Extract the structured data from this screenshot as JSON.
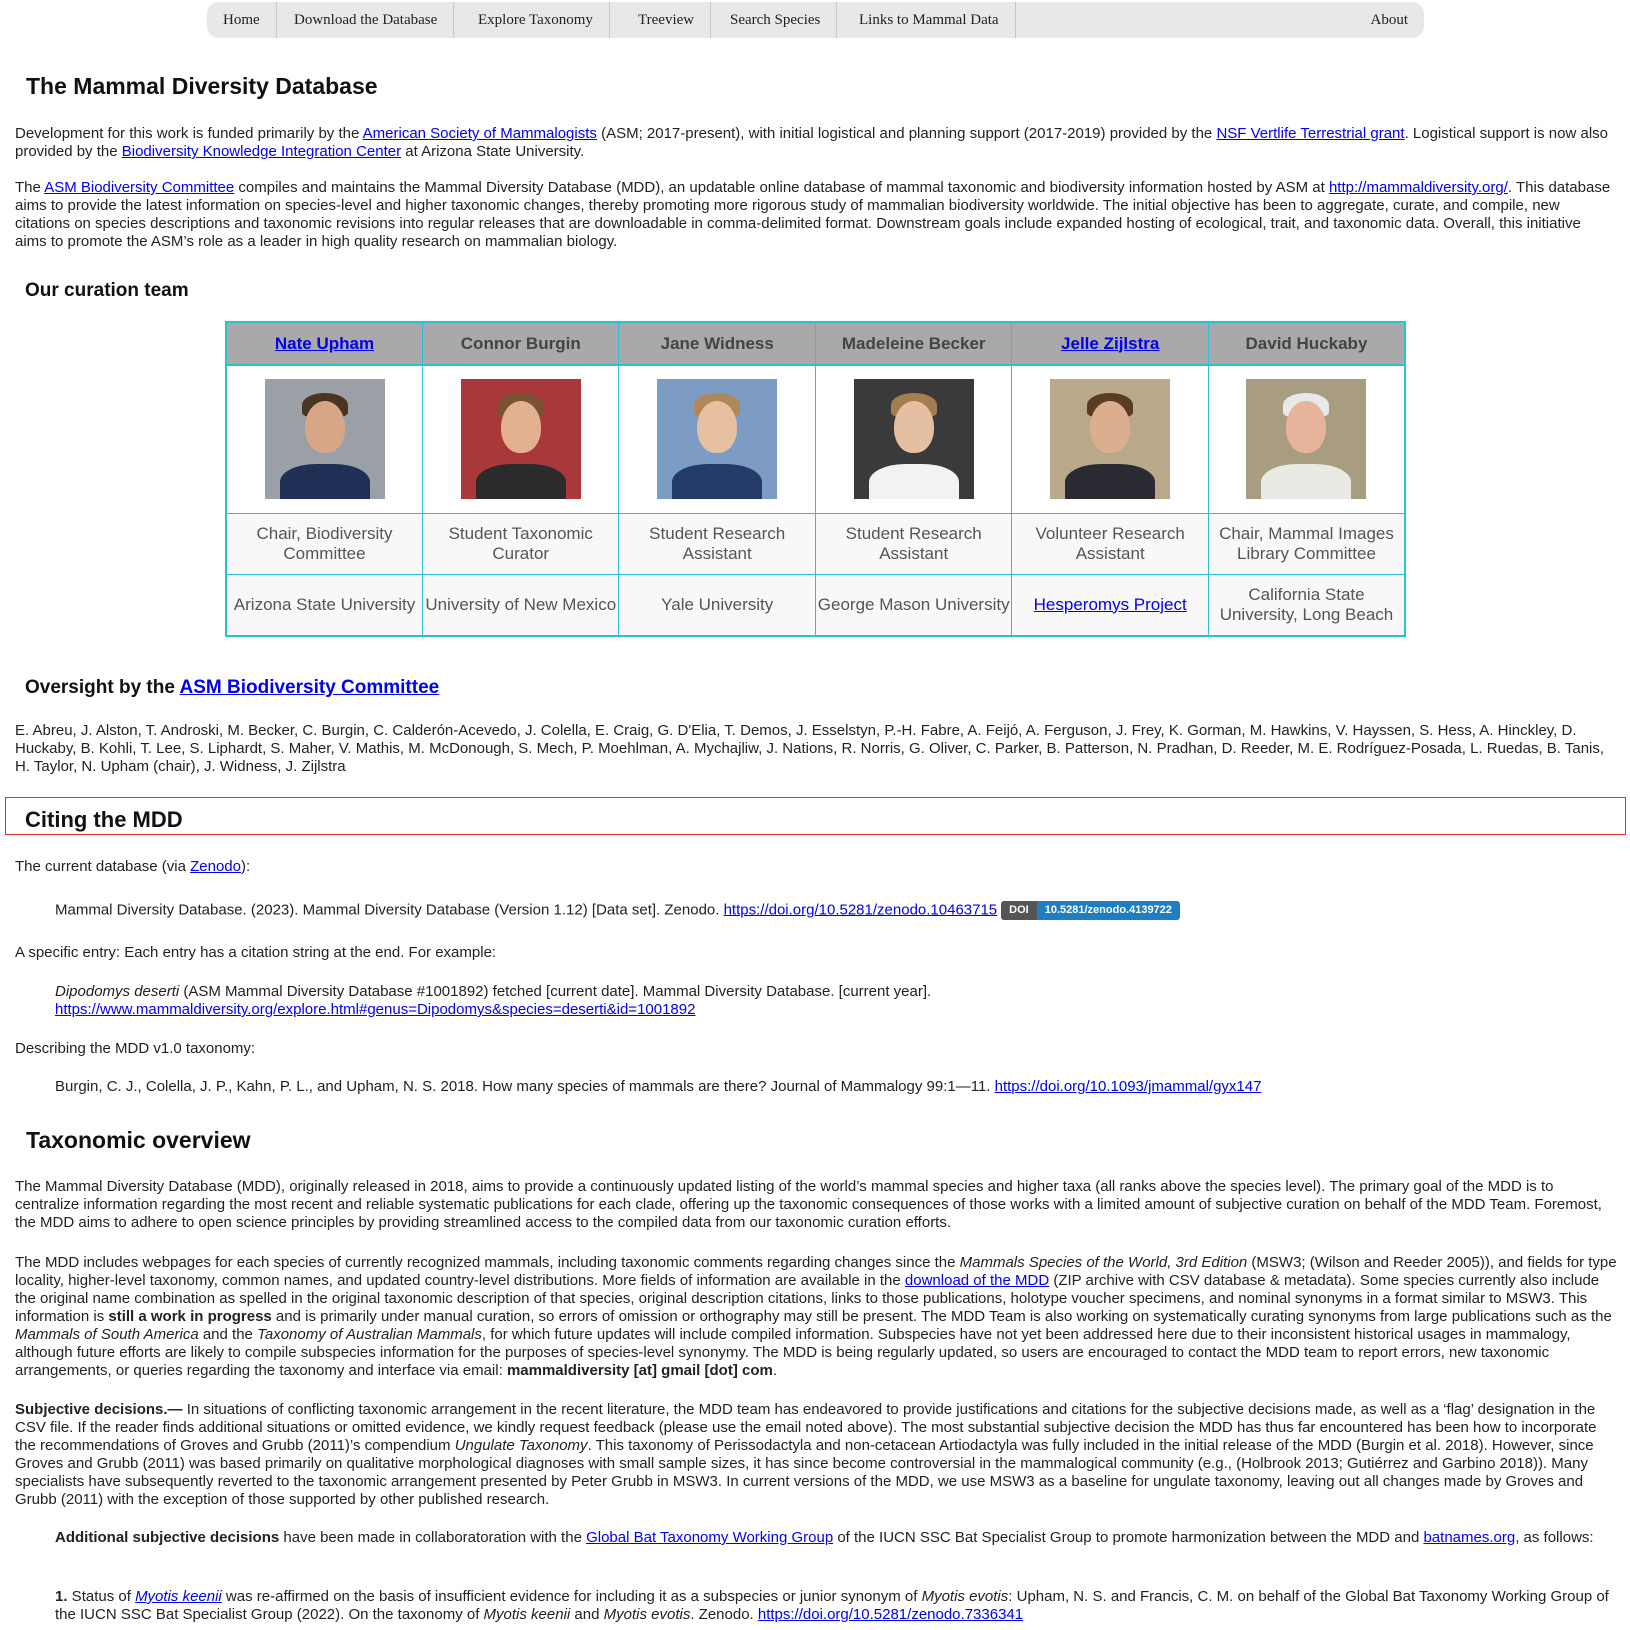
{
  "nav": {
    "home": "Home",
    "download": "Download the Database",
    "explore": "Explore Taxonomy",
    "treeview": "Treeview",
    "search": "Search Species",
    "links": "Links to Mammal Data",
    "about": "About"
  },
  "title": "The Mammal Diversity Database",
  "intro1": {
    "t1": "Development for this work is funded primarily by the ",
    "l1": "American Society of Mammalogists",
    "t2": " (ASM; 2017-present), with initial logistical and planning support (2017-2019) provided by the ",
    "l2": "NSF Vertlife Terrestrial grant",
    "t3": ". Logistical support is now also provided by the ",
    "l3": "Biodiversity Knowledge Integration Center",
    "t4": " at Arizona State University."
  },
  "intro2": {
    "t1": "The ",
    "l1": "ASM Biodiversity Committee",
    "t2": " compiles and maintains the Mammal Diversity Database (MDD), an updatable online database of mammal taxonomic and biodiversity information hosted by ASM at ",
    "l2": "http://mammaldiversity.org/",
    "t3": ". This database aims to provide the latest information on species-level and higher taxonomic changes, thereby promoting more rigorous study of mammalian biodiversity worldwide. The initial objective has been to aggregate, curate, and compile, new citations on species descriptions and taxonomic revisions into regular releases that are downloadable in comma-delimited format. Downstream goals include expanded hosting of ecological, trait, and taxonomic data. Overall, this initiative aims to promote the ASM’s role as a leader in high quality research on mammalian biology."
  },
  "team_heading": "Our curation team",
  "team": [
    {
      "name": "Nate Upham",
      "link": true,
      "role": "Chair, Biodiversity Committee",
      "inst": "Arizona State University",
      "inst_link": false,
      "bg": "#9aa0a6",
      "skin": "#d7a686",
      "hair": "#4a3524",
      "shirt": "#1f2f55"
    },
    {
      "name": "Connor Burgin",
      "link": false,
      "role": "Student Taxonomic Curator",
      "inst": "University of New Mexico",
      "inst_link": false,
      "bg": "#a8383a",
      "skin": "#e3b090",
      "hair": "#7a5132",
      "shirt": "#2b2b2b"
    },
    {
      "name": "Jane Widness",
      "link": false,
      "role": "Student Research Assistant",
      "inst": "Yale University",
      "inst_link": false,
      "bg": "#7c9cc4",
      "skin": "#e6c0a0",
      "hair": "#b08758",
      "shirt": "#243a6a"
    },
    {
      "name": "Madeleine Becker",
      "link": false,
      "role": "Student Research Assistant",
      "inst": "George Mason University",
      "inst_link": false,
      "bg": "#3a3a3a",
      "skin": "#e4bfa2",
      "hair": "#a57e50",
      "shirt": "#f2f2f2"
    },
    {
      "name": "Jelle Zijlstra",
      "link": true,
      "role": "Volunteer Research Assistant",
      "inst": "Hesperomys Project",
      "inst_link": true,
      "bg": "#b9a98a",
      "skin": "#dbae90",
      "hair": "#5a3c24",
      "shirt": "#2a2a33"
    },
    {
      "name": "David Huckaby",
      "link": false,
      "role": "Chair, Mammal Images Library Committee",
      "inst": "California State University, Long Beach",
      "inst_link": false,
      "bg": "#a89d80",
      "skin": "#e7b39a",
      "hair": "#e8e8e8",
      "shirt": "#eaeae4"
    }
  ],
  "oversight": {
    "t1": "Oversight by the ",
    "l1": "ASM Biodiversity Committee",
    "members": "E. Abreu, J. Alston, T. Androski, M. Becker, C. Burgin, C. Calderón-Acevedo, J. Colella, E. Craig, G. D'Elia, T. Demos, J. Esselstyn, P.-H. Fabre, A. Feijó, A. Ferguson, J. Frey, K. Gorman, M. Hawkins, V. Hayssen, S. Hess, A. Hinckley, D. Huckaby, B. Kohli, T. Lee, S. Liphardt, S. Maher, V. Mathis, M. McDonough, S. Mech, P. Moehlman, A. Mychajliw, J. Nations, R. Norris, G. Oliver, C. Parker, B. Patterson, N. Pradhan, D. Reeder, M. E. Rodríguez-Posada, L. Ruedas, B. Tanis, H. Taylor, N. Upham (chair), J. Widness, J. Zijlstra"
  },
  "citing": {
    "heading": "Citing the MDD",
    "current_t1": "The current database (via ",
    "current_l1": "Zenodo",
    "current_t2": "):",
    "db_cite": "Mammal Diversity Database. (2023). Mammal Diversity Database (Version 1.12) [Data set]. Zenodo. ",
    "db_link": "https://doi.org/10.5281/zenodo.10463715",
    "badge_left": "DOI",
    "badge_right": "10.5281/zenodo.4139722",
    "specific": "A specific entry: Each entry has a citation string at the end. For example:",
    "example_species": "Dipodomys deserti",
    "example_text": " (ASM Mammal Diversity Database #1001892) fetched [current date]. Mammal Diversity Database. [current year].",
    "example_link": "https://www.mammaldiversity.org/explore.html#genus=Dipodomys&species=deserti&id=1001892",
    "describing": "Describing the MDD v1.0 taxonomy:",
    "burgin": "Burgin, C. J., Colella, J. P., Kahn, P. L., and Upham, N. S. 2018. How many species of mammals are there? Journal of Mammalogy 99:1—11. ",
    "burgin_link": "https://doi.org/10.1093/jmammal/gyx147"
  },
  "taxonomic": {
    "heading": "Taxonomic overview",
    "p1": "The Mammal Diversity Database (MDD), originally released in 2018, aims to provide a continuously updated listing of the world’s mammal species and higher taxa (all ranks above the species level). The primary goal of the MDD is to centralize information regarding the most recent and reliable systematic publications for each clade, offering up the taxonomic consequences of those works with a limited amount of subjective curation on behalf of the MDD Team. Foremost, the MDD aims to adhere to open science principles by providing streamlined access to the compiled data from our taxonomic curation efforts.",
    "p2_t1": "The MDD includes webpages for each species of currently recognized mammals, including taxonomic comments regarding changes since the ",
    "p2_i1": "Mammals Species of the World, 3rd Edition",
    "p2_t2": " (MSW3; (Wilson and Reeder 2005)), and fields for type locality, higher-level taxonomy, common names, and updated country-level distributions. More fields of information are available in the ",
    "p2_l1": "download of the MDD",
    "p2_t3": " (ZIP archive with CSV database & metadata). Some species currently also include the original name combination as spelled in the original taxonomic description of that species, original description citations, links to those publications, holotype voucher specimens, and nominal synonyms in a format similar to MSW3. This information is ",
    "p2_b1": "still a work in progress",
    "p2_t4": " and is primarily under manual curation, so errors of omission or orthography may still be present. The MDD Team is also working on systematically curating synonyms from large publications such as the ",
    "p2_i2": "Mammals of South America",
    "p2_t5": " and the ",
    "p2_i3": "Taxonomy of Australian Mammals",
    "p2_t6": ", for which future updates will include compiled information. Subspecies have not yet been addressed here due to their inconsistent historical usages in mammalogy, although future efforts are likely to compile subspecies information for the purposes of species-level synonymy. The MDD is being regularly updated, so users are encouraged to contact the MDD team to report errors, new taxonomic arrangements, or queries regarding the taxonomy and interface via email: ",
    "p2_b2": "mammaldiversity [at] gmail [dot] com",
    "p2_t7": ".",
    "p3_b1": "Subjective decisions.—",
    "p3_t1": " In situations of conflicting taxonomic arrangement in the recent literature, the MDD team has endeavored to provide justifications and citations for the subjective decisions made, as well as a ‘flag’ designation in the CSV file. If the reader finds additional situations or omitted evidence, we kindly request feedback (please use the email noted above). The most substantial subjective decision the MDD has thus far encountered has been how to incorporate the recommendations of Groves and Grubb (2011)’s compendium ",
    "p3_i1": "Ungulate Taxonomy",
    "p3_t2": ". This taxonomy of Perissodactyla and non-cetacean Artiodactyla was fully included in the initial release of the MDD (Burgin et al. 2018). However, since Groves and Grubb (2011) was based primarily on qualitative morphological diagnoses with small sample sizes, it has since become controversial in the mammalogical community (e.g., (Holbrook 2013; Gutiérrez and Garbino 2018)). Many specialists have subsequently reverted to the taxonomic arrangement presented by Peter Grubb in MSW3. In current versions of the MDD, we use MSW3 as a baseline for ungulate taxonomy, leaving out all changes made by Groves and Grubb (2011) with the exception of those supported by other published research.",
    "p4_b1": "Additional subjective decisions",
    "p4_t1": " have been made in collaboratoration with the ",
    "p4_l1": "Global Bat Taxonomy Working Group",
    "p4_t2": " of the IUCN SSC Bat Specialist Group to promote harmonization between the MDD and ",
    "p4_l2": "batnames.org",
    "p4_t3": ", as follows:",
    "p5_b1": "1.",
    "p5_t1": " Status of ",
    "p5_l1": "Myotis keenii",
    "p5_t2": " was re-affirmed on the basis of insufficient evidence for including it as a subspecies or junior synonym of ",
    "p5_i1": "Myotis evotis",
    "p5_t3": ": Upham, N. S. and Francis, C. M. on behalf of the Global Bat Taxonomy Working Group of the IUCN SSC Bat Specialist Group (2022). On the taxonomy of ",
    "p5_i2": "Myotis keenii",
    "p5_t4": " and ",
    "p5_i3": "Myotis evotis",
    "p5_t5": ". Zenodo. ",
    "p5_l2": "https://doi.org/10.5281/zenodo.7336341"
  }
}
